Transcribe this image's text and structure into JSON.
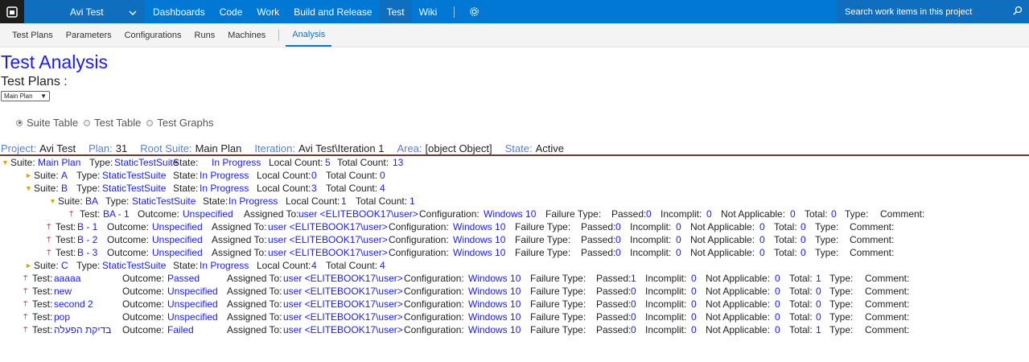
{
  "topbar": {
    "project_name": "Avi Test",
    "nav": [
      "Dashboards",
      "Code",
      "Work",
      "Build and Release",
      "Test",
      "Wiki"
    ],
    "active_nav": "Test",
    "search_placeholder": "Search work items in this project"
  },
  "subnav": {
    "items": [
      "Test Plans",
      "Parameters",
      "Configurations",
      "Runs",
      "Machines"
    ],
    "active": "Analysis"
  },
  "page": {
    "title": "Test Analysis",
    "subtitle": "Test Plans :",
    "plan_select": "Main Plan",
    "radios": [
      {
        "label": "Suite Table",
        "checked": true
      },
      {
        "label": "Test Table",
        "checked": false
      },
      {
        "label": "Test Graphs",
        "checked": false
      }
    ]
  },
  "info": {
    "project_label": "Project:",
    "project": "Avi Test",
    "plan_label": "Plan:",
    "plan": "31",
    "root_label": "Root Suite:",
    "root": "Main Plan",
    "iteration_label": "Iteration:",
    "iteration": "Avi Test\\Iteration 1",
    "area_label": "Area:",
    "area": "[object Object]",
    "state_label": "State:",
    "state": "Active"
  },
  "labels": {
    "suite": "Suite:",
    "type": "Type:",
    "state": "State:",
    "local_count": "Local Count:",
    "total_count": "Total Count:",
    "test": "Test:",
    "outcome": "Outcome:",
    "assigned": "Assigned To:",
    "configuration": "Configuration:",
    "failure_type": "Failure Type:",
    "passed": "Passed:",
    "incomplit": "Incomplit:",
    "not_applicable": "Not Applicable:",
    "total": "Total:",
    "type2": "Type:",
    "comment": "Comment:"
  },
  "suites": [
    {
      "level": 0,
      "name": "Main Plan",
      "type": "StaticTestSuite",
      "state": "In Progress",
      "local": "5",
      "total": "13"
    },
    {
      "level": 1,
      "name": "A",
      "type": "StaticTestSuite",
      "state": "In Progress",
      "local": "0",
      "total": "0"
    },
    {
      "level": 1,
      "name": "B",
      "type": "StaticTestSuite",
      "state": "In Progress",
      "local": "3",
      "total": "4"
    },
    {
      "level": 2,
      "name": "BA",
      "type": "StaticTestSuite",
      "state": "In Progress",
      "local": "1",
      "total": "1"
    },
    {
      "level": 1,
      "name": "C",
      "type": "StaticTestSuite",
      "state": "In Progress",
      "local": "4",
      "total": "4"
    }
  ],
  "tests_ba": [
    {
      "name": "BA - 1",
      "outcome": "Unspecified",
      "assigned": "user <ELITEBOOK17\\user>",
      "config": "Windows 10",
      "passed": "0",
      "incomplit": "0",
      "na": "0",
      "total": "0"
    }
  ],
  "tests_b": [
    {
      "name": "B - 1",
      "outcome": "Unspecified",
      "assigned": "user <ELITEBOOK17\\user>",
      "config": "Windows 10",
      "passed": "0",
      "incomplit": "0",
      "na": "0",
      "total": "0"
    },
    {
      "name": "B - 2",
      "outcome": "Unspecified",
      "assigned": "user <ELITEBOOK17\\user>",
      "config": "Windows 10",
      "passed": "0",
      "incomplit": "0",
      "na": "0",
      "total": "0"
    },
    {
      "name": "B - 3",
      "outcome": "Unspecified",
      "assigned": "user <ELITEBOOK17\\user>",
      "config": "Windows 10",
      "passed": "0",
      "incomplit": "0",
      "na": "0",
      "total": "0"
    }
  ],
  "tests_main": [
    {
      "name": "aaaaa",
      "outcome": "Passed",
      "assigned": "user <ELITEBOOK17\\user>",
      "config": "Windows 10",
      "passed": "1",
      "incomplit": "0",
      "na": "0",
      "total": "1"
    },
    {
      "name": "new",
      "outcome": "Unspecified",
      "assigned": "user <ELITEBOOK17\\user>",
      "config": "Windows 10",
      "passed": "0",
      "incomplit": "0",
      "na": "0",
      "total": "0"
    },
    {
      "name": "second 2",
      "outcome": "Unspecified",
      "assigned": "user <ELITEBOOK17\\user>",
      "config": "Windows 10",
      "passed": "0",
      "incomplit": "0",
      "na": "0",
      "total": "0"
    },
    {
      "name": "pop",
      "outcome": "Unspecified",
      "assigned": "user <ELITEBOOK17\\user>",
      "config": "Windows 10",
      "passed": "0",
      "incomplit": "0",
      "na": "0",
      "total": "0"
    },
    {
      "name": "בדיקת הפעלה",
      "outcome": "Failed",
      "assigned": "user <ELITEBOOK17\\user>",
      "config": "Windows 10",
      "passed": "0",
      "incomplit": "0",
      "na": "0",
      "total": "1"
    }
  ]
}
